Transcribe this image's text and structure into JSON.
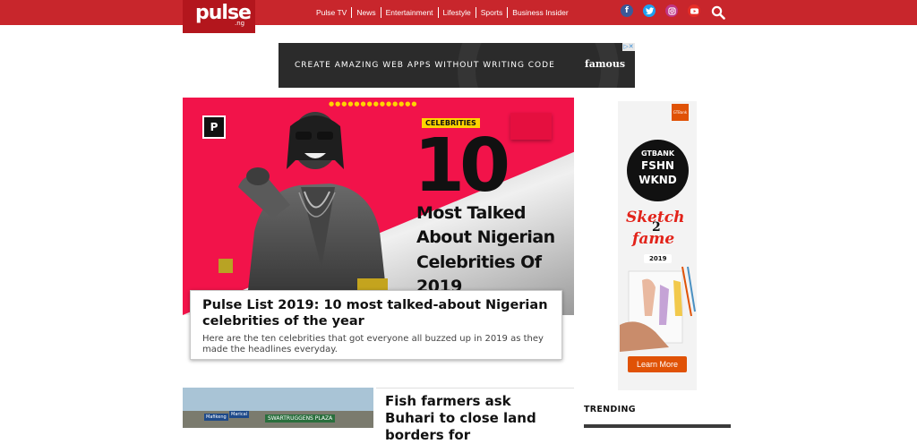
{
  "header": {
    "logo_text": "pulse",
    "logo_sub": ".ng",
    "nav": [
      "Pulse TV",
      "News",
      "Entertainment",
      "Lifestyle",
      "Sports",
      "Business Insider"
    ],
    "social_icons": [
      "facebook-icon",
      "twitter-icon",
      "instagram-icon",
      "youtube-icon"
    ],
    "colors": {
      "bar": "#c8262c",
      "facebook": "#3b5998",
      "twitter": "#1da1f2",
      "instagram": "#c13584",
      "youtube": "#e52d27"
    }
  },
  "ad_banner": {
    "text": "CREATE AMAZING WEB APPS WITHOUT WRITING CODE",
    "brand": "famous"
  },
  "hero": {
    "image": {
      "tag": "CELEBRITIES",
      "number": "10",
      "lines": [
        "Most Talked",
        "About Nigerian",
        "Celebrities Of",
        "2019"
      ]
    },
    "title": "Pulse List 2019: 10 most talked-about Nigerian celebrities of the year",
    "description": "Here are the ten celebrities that got everyone all buzzed up in 2019 as they made the headlines everyday."
  },
  "side_ad": {
    "badge": "GTBank",
    "circle": [
      "GTBANK",
      "FSHN",
      "WKND"
    ],
    "sketch": [
      "Sketch",
      "2",
      "fame"
    ],
    "year": "2019",
    "cta": "Learn More"
  },
  "second_article": {
    "title": "Fish farmers ask Buhari to close land borders for",
    "signs": [
      "Mafikeng",
      "Marical",
      "SWARTRUGGENS PLAZA"
    ]
  },
  "sidebar": {
    "trending_label": "TRENDING"
  }
}
